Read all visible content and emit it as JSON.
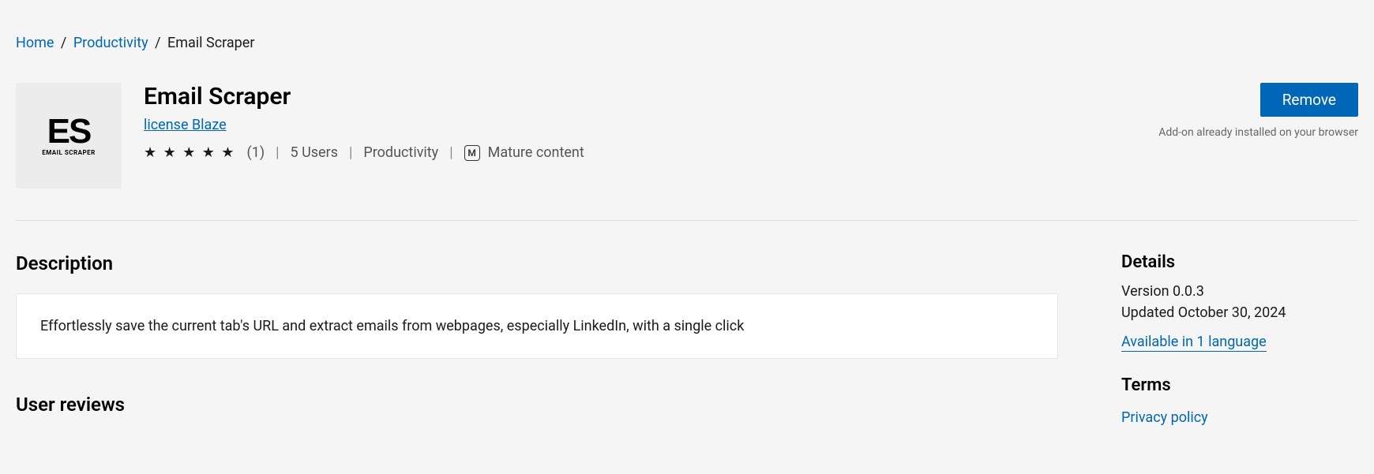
{
  "breadcrumb": {
    "home": "Home",
    "category": "Productivity",
    "current": "Email Scraper"
  },
  "extension": {
    "name": "Email Scraper",
    "publisher": "license Blaze",
    "rating_count": "(1)",
    "users": "5 Users",
    "category": "Productivity",
    "mature_badge": "M",
    "mature_label": "Mature content",
    "icon_letters": "ES",
    "icon_sub": "EMAIL SCRAPER"
  },
  "action": {
    "remove_label": "Remove",
    "installed_note": "Add-on already installed on your browser"
  },
  "sections": {
    "description_heading": "Description",
    "description_text": "Effortlessly save the current tab's URL and extract emails from webpages, especially LinkedIn, with a single click",
    "reviews_heading": "User reviews"
  },
  "details": {
    "heading": "Details",
    "version": "Version 0.0.3",
    "updated": "Updated October 30, 2024",
    "languages_link": "Available in 1 language"
  },
  "terms": {
    "heading": "Terms",
    "privacy_link": "Privacy policy"
  }
}
